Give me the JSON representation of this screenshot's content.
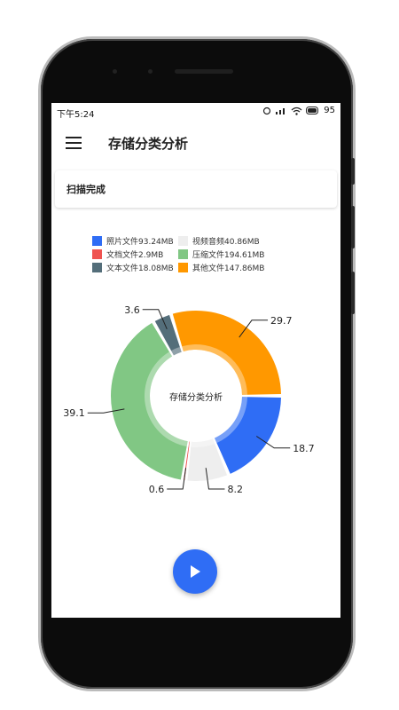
{
  "status_bar": {
    "time": "下午5:24",
    "battery": "95"
  },
  "app_bar": {
    "title": "存储分类分析"
  },
  "scan_card": {
    "text": "扫描完成"
  },
  "chart_data": {
    "type": "pie",
    "title": "",
    "center_label": "存储分类分析",
    "legend": [
      {
        "label": "照片文件93.24MB",
        "color": "#2f6df5"
      },
      {
        "label": "视频音频40.86MB",
        "color": "#eeeeee"
      },
      {
        "label": "文档文件2.9MB",
        "color": "#ef5350"
      },
      {
        "label": "压缩文件194.61MB",
        "color": "#81c784"
      },
      {
        "label": "文本文件18.08MB",
        "color": "#546e7a"
      },
      {
        "label": "其他文件147.86MB",
        "color": "#ff9800"
      }
    ],
    "slices": [
      {
        "name": "照片文件",
        "value": 18.7,
        "label": "18.7",
        "color": "#2f6df5"
      },
      {
        "name": "视频音频",
        "value": 8.2,
        "label": "8.2",
        "color": "#eeeeee"
      },
      {
        "name": "文档文件",
        "value": 0.6,
        "label": "0.6",
        "color": "#ef5350"
      },
      {
        "name": "压缩文件",
        "value": 39.1,
        "label": "39.1",
        "color": "#81c784"
      },
      {
        "name": "文本文件",
        "value": 3.6,
        "label": "3.6",
        "color": "#546e7a"
      },
      {
        "name": "其他文件",
        "value": 29.7,
        "label": "29.7",
        "color": "#ff9800"
      }
    ]
  },
  "fab": {
    "icon": "play-icon"
  }
}
